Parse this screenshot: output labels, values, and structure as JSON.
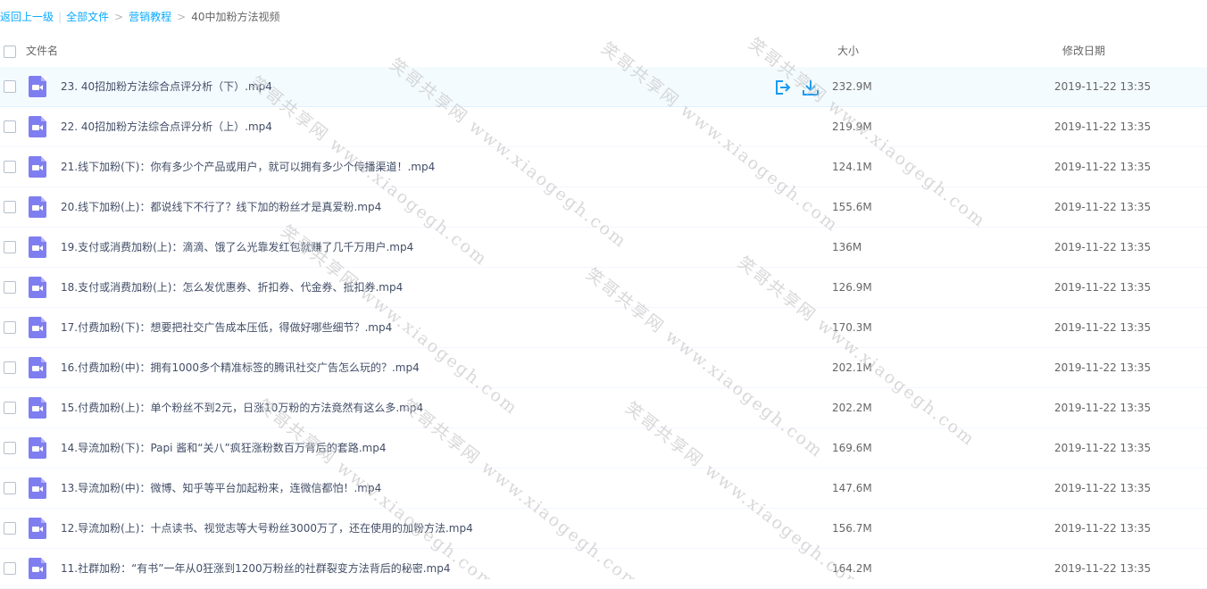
{
  "breadcrumb": {
    "back": "返回上一级",
    "all": "全部文件",
    "folder": "营销教程",
    "current": "40中加粉方法视频"
  },
  "header": {
    "name": "文件名",
    "size": "大小",
    "date": "修改日期"
  },
  "files": [
    {
      "name": "23. 40招加粉方法综合点评分析（下）.mp4",
      "size": "232.9M",
      "date": "2019-11-22 13:35"
    },
    {
      "name": "22. 40招加粉方法综合点评分析（上）.mp4",
      "size": "219.9M",
      "date": "2019-11-22 13:35"
    },
    {
      "name": "21.线下加粉(下)：你有多少个产品或用户，就可以拥有多少个传播渠道！.mp4",
      "size": "124.1M",
      "date": "2019-11-22 13:35"
    },
    {
      "name": "20.线下加粉(上)：都说线下不行了？线下加的粉丝才是真爱粉.mp4",
      "size": "155.6M",
      "date": "2019-11-22 13:35"
    },
    {
      "name": "19.支付或消费加粉(上)：滴滴、饿了么光靠发红包就赚了几千万用户.mp4",
      "size": "136M",
      "date": "2019-11-22 13:35"
    },
    {
      "name": "18.支付或消费加粉(上)：怎么发优惠券、折扣券、代金券、抵扣券.mp4",
      "size": "126.9M",
      "date": "2019-11-22 13:35"
    },
    {
      "name": "17.付费加粉(下)：想要把社交广告成本压低，得做好哪些细节？.mp4",
      "size": "170.3M",
      "date": "2019-11-22 13:35"
    },
    {
      "name": "16.付费加粉(中)：拥有1000多个精准标签的腾讯社交广告怎么玩的？.mp4",
      "size": "202.1M",
      "date": "2019-11-22 13:35"
    },
    {
      "name": "15.付费加粉(上)：单个粉丝不到2元，日涨10万粉的方法竟然有这么多.mp4",
      "size": "202.2M",
      "date": "2019-11-22 13:35"
    },
    {
      "name": "14.导流加粉(下)：Papi 酱和“关八”疯狂涨粉数百万背后的套路.mp4",
      "size": "169.6M",
      "date": "2019-11-22 13:35"
    },
    {
      "name": "13.导流加粉(中)：微博、知乎等平台加起粉来，连微信都怕！.mp4",
      "size": "147.6M",
      "date": "2019-11-22 13:35"
    },
    {
      "name": "12.导流加粉(上)：十点读书、视觉志等大号粉丝3000万了，还在使用的加粉方法.mp4",
      "size": "156.7M",
      "date": "2019-11-22 13:35"
    },
    {
      "name": "11.社群加粉：“有书”一年从0狂涨到1200万粉丝的社群裂变方法背后的秘密.mp4",
      "size": "164.2M",
      "date": "2019-11-22 13:35"
    }
  ],
  "watermark": "笑哥共享网 www.xiaogegh.com",
  "colors": {
    "link": "#09aaff",
    "icon": "#7f7ef0",
    "hover_row": "#f4fbff",
    "action_icon": "#1a9bf0"
  },
  "icons": {
    "file": "video-file-icon",
    "share": "share-icon",
    "download": "download-icon"
  }
}
